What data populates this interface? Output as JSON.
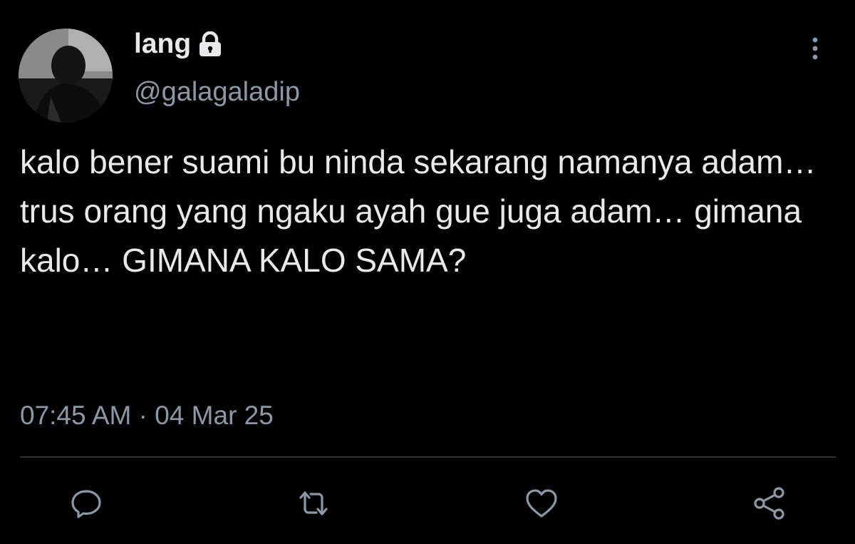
{
  "tweet": {
    "display_name": "lang",
    "handle": "@galagaladip",
    "protected_icon": "lock-icon",
    "text": "kalo bener suami bu ninda sekarang namanya adam… trus orang yang ngaku ayah gue juga adam… gimana kalo… GIMANA KALO SAMA?",
    "time": "07:45 AM",
    "separator": "·",
    "date": "04 Mar 25"
  },
  "actions": [
    {
      "icon": "reply-icon"
    },
    {
      "icon": "retweet-icon"
    },
    {
      "icon": "like-icon"
    },
    {
      "icon": "share-icon"
    }
  ],
  "colors": {
    "background": "#000000",
    "primary_text": "#e7e9ea",
    "secondary_text": "#8b98a5",
    "divider": "#2f3336"
  }
}
